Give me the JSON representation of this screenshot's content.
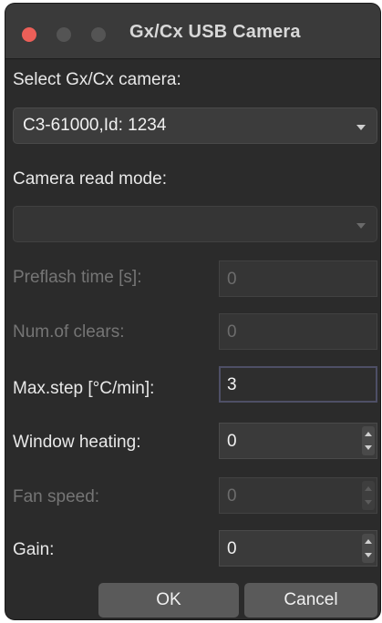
{
  "window": {
    "title": "Gx/Cx USB Camera"
  },
  "camera_select": {
    "label": "Select Gx/Cx camera:",
    "selected": "C3-61000,Id: 1234"
  },
  "read_mode": {
    "label": "Camera read mode:",
    "selected": ""
  },
  "fields": {
    "preflash": {
      "label": "Preflash time [s]:",
      "value": "0",
      "enabled": false
    },
    "clears": {
      "label": "Num.of clears:",
      "value": "0",
      "enabled": false
    },
    "max_step": {
      "label": "Max.step [°C/min]:",
      "value": "3",
      "enabled": true
    },
    "window_heating": {
      "label": "Window heating:",
      "value": "0",
      "enabled": true
    },
    "fan_speed": {
      "label": "Fan speed:",
      "value": "0",
      "enabled": false
    },
    "gain": {
      "label": "Gain:",
      "value": "0",
      "enabled": true
    }
  },
  "buttons": {
    "ok": "OK",
    "cancel": "Cancel"
  },
  "colors": {
    "window_bg": "#2b2b2b",
    "close_button": "#ec5f58",
    "button_bg": "#5a5a5a",
    "focus_border": "#4e4f66"
  }
}
